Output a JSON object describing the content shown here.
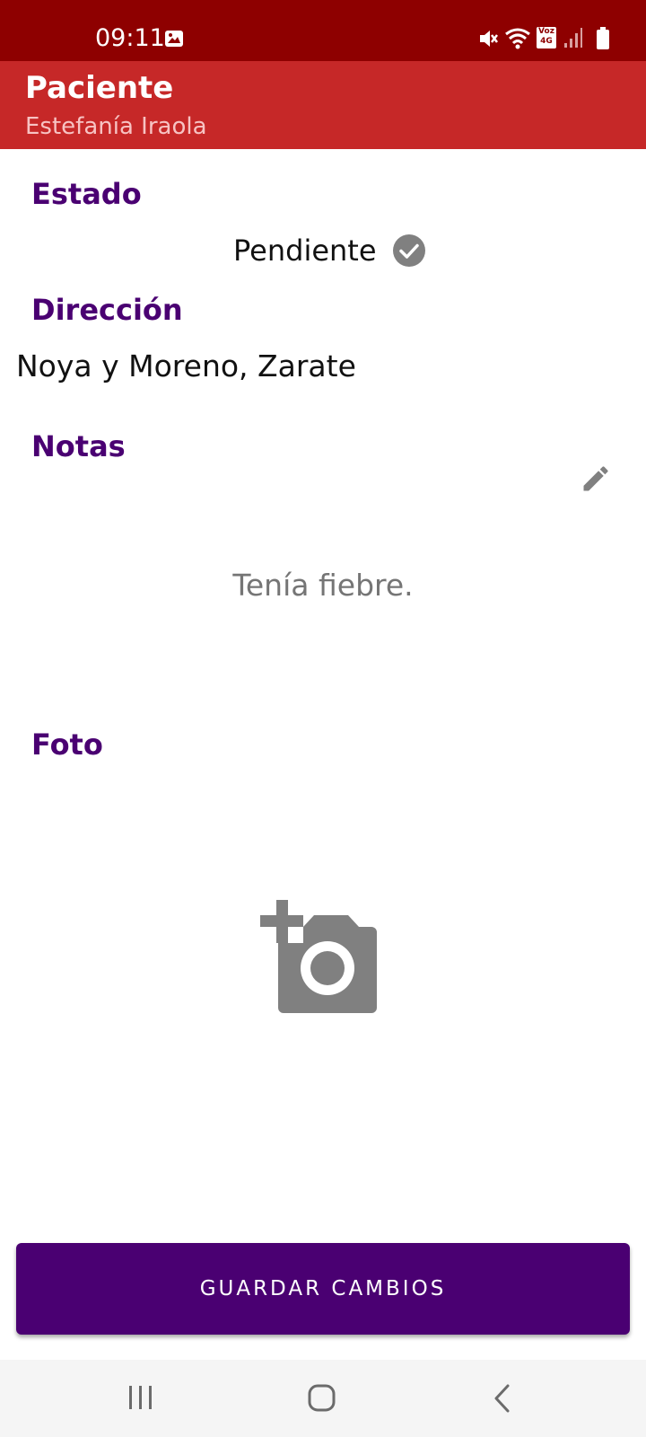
{
  "status_bar": {
    "time": "09:11",
    "network_badge_top": "Voz",
    "network_badge_bottom": "4G",
    "icons": [
      "gallery-icon",
      "mute-icon",
      "wifi-icon",
      "volte-icon",
      "signal-icon",
      "battery-icon"
    ]
  },
  "app_bar": {
    "title": "Paciente",
    "subtitle": "Estefanía Iraola",
    "background": "#c62828"
  },
  "sections": {
    "estado_label": "Estado",
    "estado_value": "Pendiente",
    "direccion_label": "Dirección",
    "direccion_value": "Noya y Moreno, Zarate",
    "notas_label": "Notas",
    "notas_value": "Tenía fiebre.",
    "foto_label": "Foto"
  },
  "actions": {
    "save_label": "GUARDAR CAMBIOS"
  },
  "colors": {
    "status_bar": "#8e0000",
    "accent": "#4a0072",
    "icon_gray": "#808080"
  },
  "nav_bar": {
    "icons": [
      "recent-apps-icon",
      "home-icon",
      "back-icon"
    ]
  }
}
